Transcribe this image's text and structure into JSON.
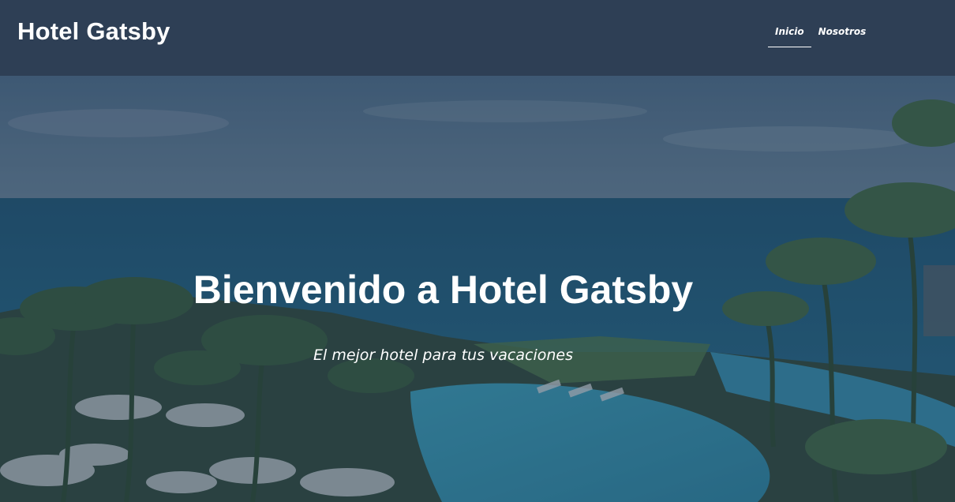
{
  "header": {
    "site_title": "Hotel Gatsby",
    "nav": [
      {
        "label": "Inicio",
        "active": true
      },
      {
        "label": "Nosotros",
        "active": false
      }
    ]
  },
  "hero": {
    "title": "Bienvenido a Hotel Gatsby",
    "subtitle": "El mejor hotel para tus vacaciones"
  },
  "colors": {
    "header_bg": "#2e3f55",
    "text": "#ffffff",
    "overlay": "#22344d"
  }
}
